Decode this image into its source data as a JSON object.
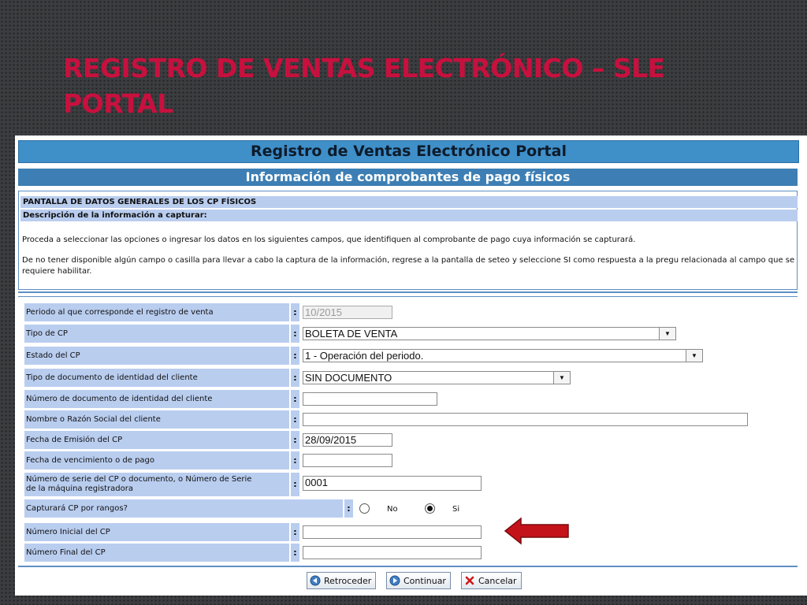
{
  "slide": {
    "title_line1": "REGISTRO DE VENTAS ELECTRÓNICO – SLE",
    "title_line2": "PORTAL"
  },
  "portal": {
    "title": "Registro de Ventas Electrónico Portal",
    "subtitle": "Información de comprobantes de pago físicos"
  },
  "info": {
    "screen_title": "PANTALLA DE DATOS GENERALES DE LOS CP FÍSICOS",
    "desc_title": "Descripción de la información a capturar:",
    "paragraph1": "Proceda a seleccionar las opciones o ingresar los datos en los siguientes campos, que identifiquen al comprobante de pago cuya información se capturará.",
    "paragraph2": "De no tener disponible algún campo o casilla para llevar a cabo la captura de la información, regrese a la pantalla de seteo y seleccione SI como respuesta a la pregu relacionada al campo que se requiere habilitar."
  },
  "form": {
    "colon": ":",
    "periodo": {
      "label": "Periodo al que corresponde el registro de venta",
      "value": "10/2015"
    },
    "tipo_cp": {
      "label": "Tipo de CP",
      "value": "BOLETA DE VENTA"
    },
    "estado_cp": {
      "label": "Estado del CP",
      "value": "1 - Operación del periodo."
    },
    "tipo_doc": {
      "label": "Tipo de documento de identidad del cliente",
      "value": "SIN DOCUMENTO"
    },
    "num_doc": {
      "label": "Número de documento de identidad del cliente",
      "value": ""
    },
    "nombre": {
      "label": "Nombre o Razón Social del cliente",
      "value": ""
    },
    "fecha_emision": {
      "label": "Fecha de Emisión del CP",
      "value": "28/09/2015"
    },
    "fecha_venc": {
      "label": "Fecha de vencimiento o de pago",
      "value": ""
    },
    "serie": {
      "label_line1": "Número de serie del CP o documento, o Número de Serie",
      "label_line2": "de la máquina registradora",
      "value": "0001"
    },
    "rangos": {
      "label": "Capturará CP por rangos?",
      "option_no": "No",
      "option_si": "Si",
      "selected": "Si"
    },
    "num_inicial": {
      "label": "Número Inicial del CP",
      "value": ""
    },
    "num_final": {
      "label": "Número Final del CP",
      "value": ""
    }
  },
  "buttons": {
    "back": "Retroceder",
    "continue": "Continuar",
    "cancel": "Cancelar"
  },
  "icons": {
    "select_arrow": "▼",
    "back_icon": "arrow-left-circle-icon",
    "continue_icon": "arrow-right-circle-icon",
    "cancel_icon": "x-mark-icon",
    "callout_arrow": "arrow-left-callout-icon"
  },
  "colors": {
    "title_red": "#c8103e",
    "banner_blue": "#3f8fc9",
    "label_blue": "#b9cdef",
    "callout_red": "#c4121a"
  }
}
